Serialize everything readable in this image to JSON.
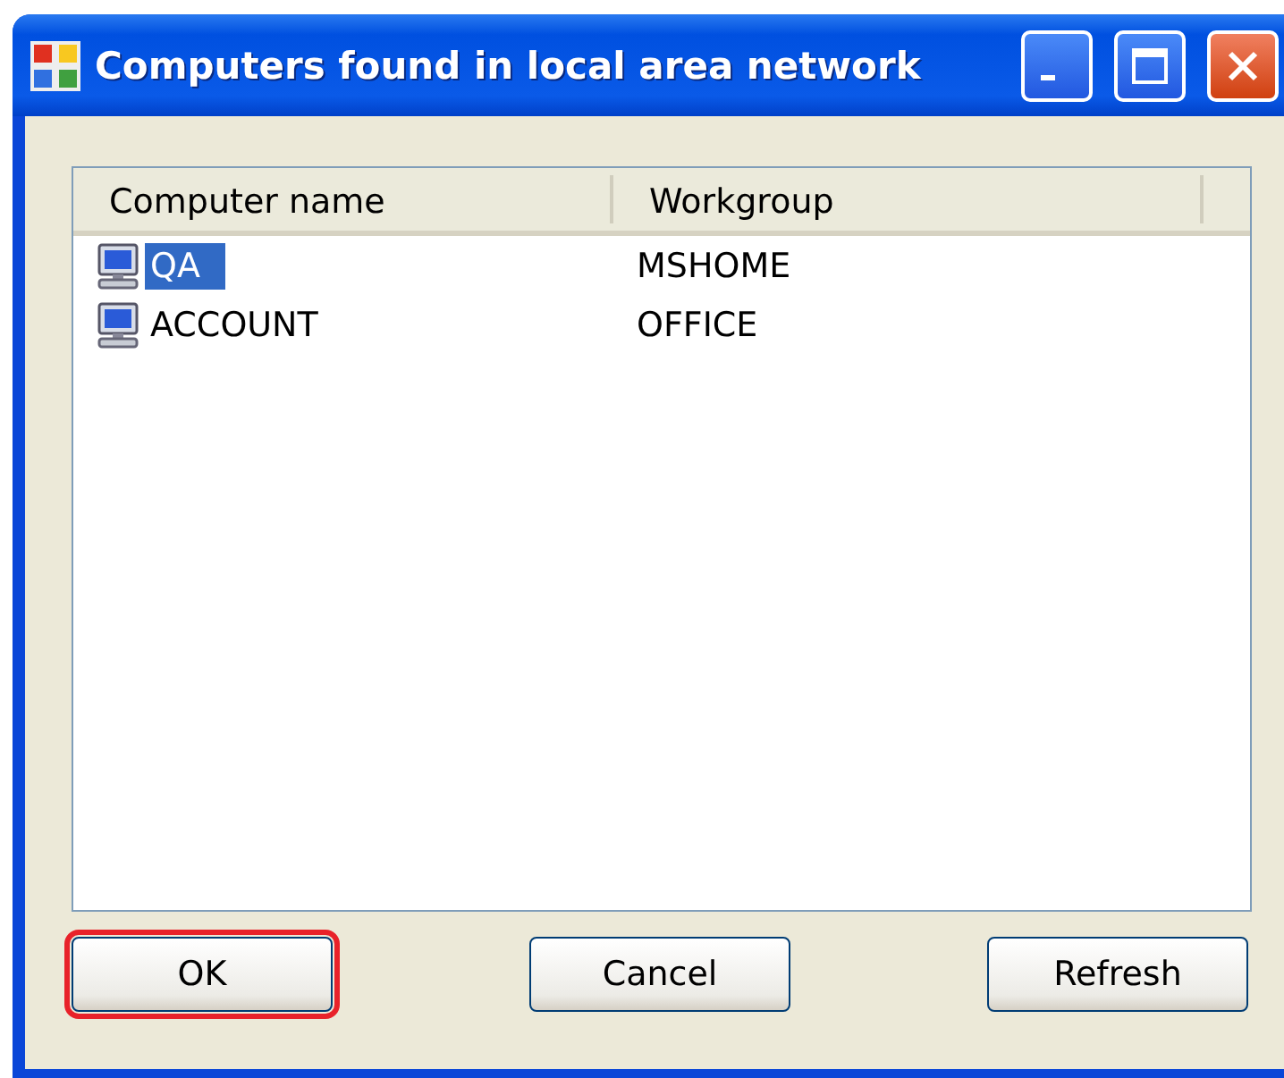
{
  "window": {
    "title": "Computers found in local area network"
  },
  "table": {
    "columns": [
      "Computer name",
      "Workgroup"
    ],
    "rows": [
      {
        "name": "QA",
        "workgroup": "MSHOME",
        "selected": true
      },
      {
        "name": "ACCOUNT",
        "workgroup": "OFFICE",
        "selected": false
      }
    ]
  },
  "buttons": [
    {
      "label": "OK",
      "highlighted": true
    },
    {
      "label": "Cancel",
      "highlighted": false
    },
    {
      "label": "Refresh",
      "highlighted": false
    }
  ]
}
